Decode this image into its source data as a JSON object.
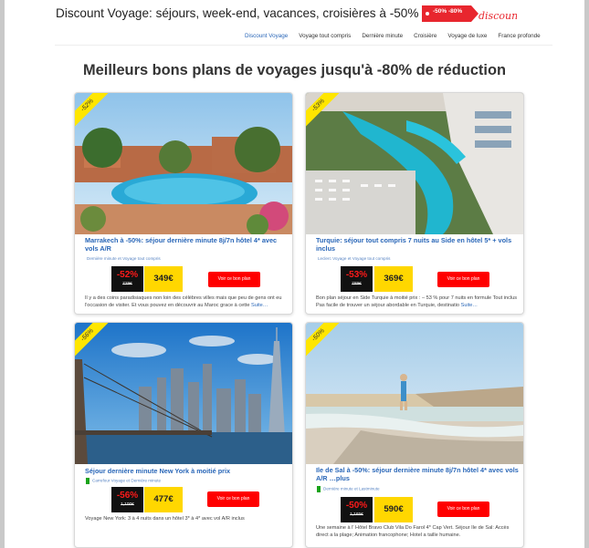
{
  "header": {
    "site_title": "Discount Voyage: séjours, week-end, vacances, croisières à -50% et +",
    "logo": {
      "badge_text": "-50% -80%",
      "wordmark": "discount"
    }
  },
  "nav": {
    "items": [
      {
        "label": "Discount Voyage",
        "active": true
      },
      {
        "label": "Voyage tout compris"
      },
      {
        "label": "Dernière minute"
      },
      {
        "label": "Croisière"
      },
      {
        "label": "Voyage de luxe"
      },
      {
        "label": "France profonde"
      }
    ]
  },
  "main": {
    "heading": "Meilleurs bons plans de voyages jusqu'à -80% de réduction",
    "cards": [
      {
        "ribbon": "-52%",
        "title": "Marrakech à -50%: séjour dernière minute 8j/7n hôtel 4* avec vols A/R",
        "categories": "Dernière minute et Voyage tout compris",
        "discount": "-52%",
        "old_price": "729€",
        "new_price": "349€",
        "cta": "Voir ce bon plan",
        "description": "Il y a des coins paradisiaques non loin des célèbres villes mais que peu de gens ont eu l'occasion de visiter. Et vous pouvez en découvrir au Maroc grace à cette",
        "more": "Suite…"
      },
      {
        "ribbon": "-53%",
        "title": "Turquie: séjour tout compris 7 nuits au Side en hôtel 5* + vols inclus",
        "categories": "Leclerc Voyage et Voyage tout compris",
        "discount": "-53%",
        "old_price": "789€",
        "new_price": "369€",
        "cta": "Voir ce bon plan",
        "description": "Bon plan séjour en Side Turquie à moitié prix : – 53 % pour 7 nuits en formule Tout inclus Pas facile de trouver un séjour abordable en Turquie, destinatio",
        "more": "Suite…"
      },
      {
        "ribbon": "-56%",
        "title": "Séjour dernière minute New York à moitié prix",
        "categories": "Carrefour Voyage et Dernière minute",
        "discount": "-56%",
        "old_price": "1,100€",
        "new_price": "477€",
        "cta": "Voir ce bon plan",
        "description": "Voyage New York: 3 à 4 nuits dans un hôtel 3* à 4* avec vol A/R inclus",
        "more": ""
      },
      {
        "ribbon": "-50%",
        "title": "Ile de Sal à -50%: séjour dernière minute 8j/7n hôtel 4* avec vols A/R …plus",
        "categories": "Dernière minute et Lastminute",
        "discount": "-50%",
        "old_price": "1,165€",
        "new_price": "590€",
        "cta": "Voir ce bon plan",
        "description": "Une semaine à l' Hôtel Bravo Club Vila Do Farol 4* Cap Vert. Séjour Ile de Sal: Accès direct a la plage; Animation francophone; Hotel a taille humaine.",
        "more": ""
      }
    ]
  },
  "colors": {
    "link_blue": "#2a67b8",
    "ribbon_yellow": "#ffe600",
    "price_yellow": "#ffd700",
    "cta_red": "#ff0000",
    "discount_red": "#ff1a1a"
  }
}
